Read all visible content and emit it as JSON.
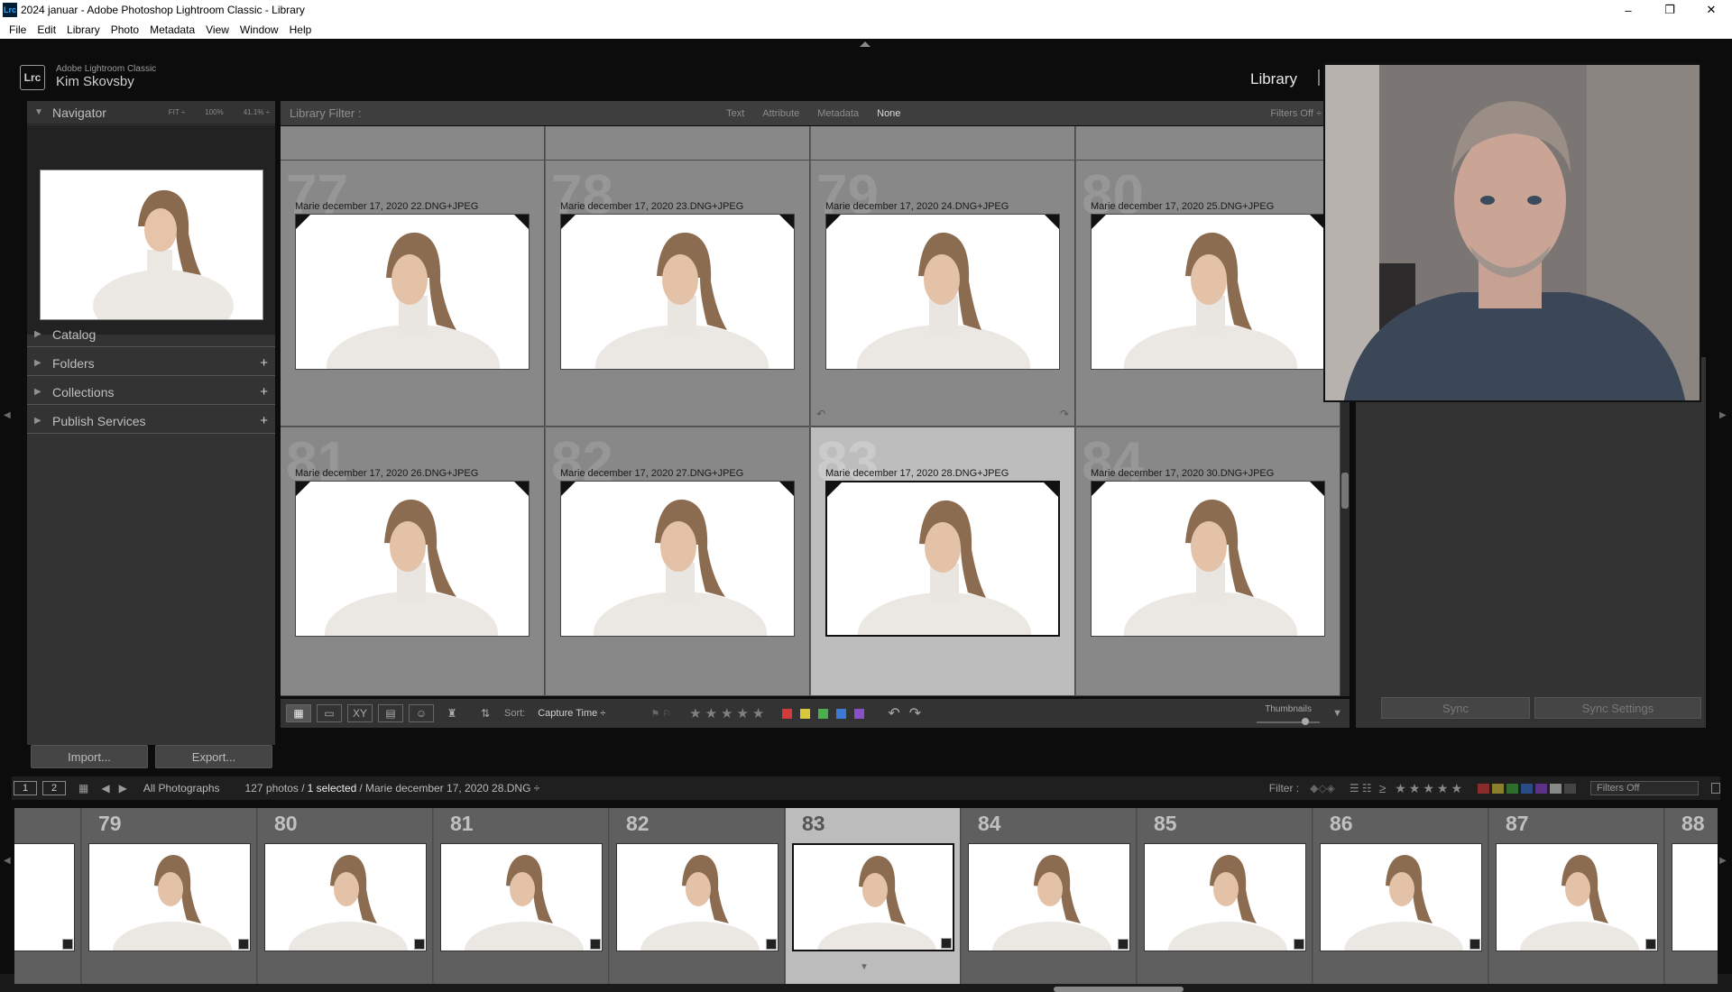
{
  "window": {
    "title": "2024 januar - Adobe Photoshop Lightroom Classic - Library",
    "icon_text": "Lrc",
    "minimize": "–",
    "restore": "❐",
    "close": "✕"
  },
  "menu": [
    "File",
    "Edit",
    "Library",
    "Photo",
    "Metadata",
    "View",
    "Window",
    "Help"
  ],
  "identity": {
    "app": "Adobe Lightroom Classic",
    "user": "Kim Skovsby",
    "logo": "Lrc"
  },
  "modules": {
    "active": "Library"
  },
  "navigator": {
    "title": "Navigator",
    "options": [
      "FIT ÷",
      "100%",
      "41.1% ÷"
    ]
  },
  "left_sections": [
    {
      "label": "Catalog",
      "plus": ""
    },
    {
      "label": "Folders",
      "plus": "+"
    },
    {
      "label": "Collections",
      "plus": "+"
    },
    {
      "label": "Publish Services",
      "plus": "+"
    }
  ],
  "left_buttons": {
    "import": "Import...",
    "export": "Export..."
  },
  "library_filter": {
    "label": "Library Filter :",
    "tabs": [
      "Text",
      "Attribute",
      "Metadata",
      "None"
    ],
    "active_tab": "None",
    "status": "Filters Off ÷"
  },
  "grid": {
    "rows": [
      [
        {
          "num": "77",
          "label": "Marie december 17, 2020 22.DNG+JPEG"
        },
        {
          "num": "78",
          "label": "Marie december 17, 2020 23.DNG+JPEG"
        },
        {
          "num": "79",
          "label": "Marie december 17, 2020 24.DNG+JPEG"
        },
        {
          "num": "80",
          "label": "Marie december 17, 2020 25.DNG+JPEG"
        }
      ],
      [
        {
          "num": "81",
          "label": "Marie december 17, 2020 26.DNG+JPEG"
        },
        {
          "num": "82",
          "label": "Marie december 17, 2020 27.DNG+JPEG"
        },
        {
          "num": "83",
          "label": "Marie december 17, 2020 28.DNG+JPEG"
        },
        {
          "num": "84",
          "label": "Marie december 17, 2020 30.DNG+JPEG"
        }
      ]
    ],
    "selected": "83"
  },
  "toolbar": {
    "sort_label": "Sort:",
    "sort_value": "Capture Time ÷",
    "stars": "★★★★★",
    "color_labels": [
      "#d33b3b",
      "#d8c83a",
      "#4bb04b",
      "#3f79d6",
      "#8a4fc9"
    ],
    "thumbnails_label": "Thumbnails"
  },
  "right_buttons": {
    "sync": "Sync",
    "sync_settings": "Sync Settings"
  },
  "filmstrip_header": {
    "mon1": "1",
    "mon2": "2",
    "source": "All Photographs",
    "count_text": "127 photos /",
    "selected_text": "1 selected",
    "file_text": "/ Marie december 17, 2020 28.DNG ÷",
    "filter_label": "Filter :",
    "stars": "≥ ★★★★★",
    "filters_off": "Filters Off"
  },
  "filmstrip": {
    "items": [
      "",
      "79",
      "80",
      "81",
      "82",
      "83",
      "84",
      "85",
      "86",
      "87",
      "88"
    ],
    "selected": "83"
  }
}
